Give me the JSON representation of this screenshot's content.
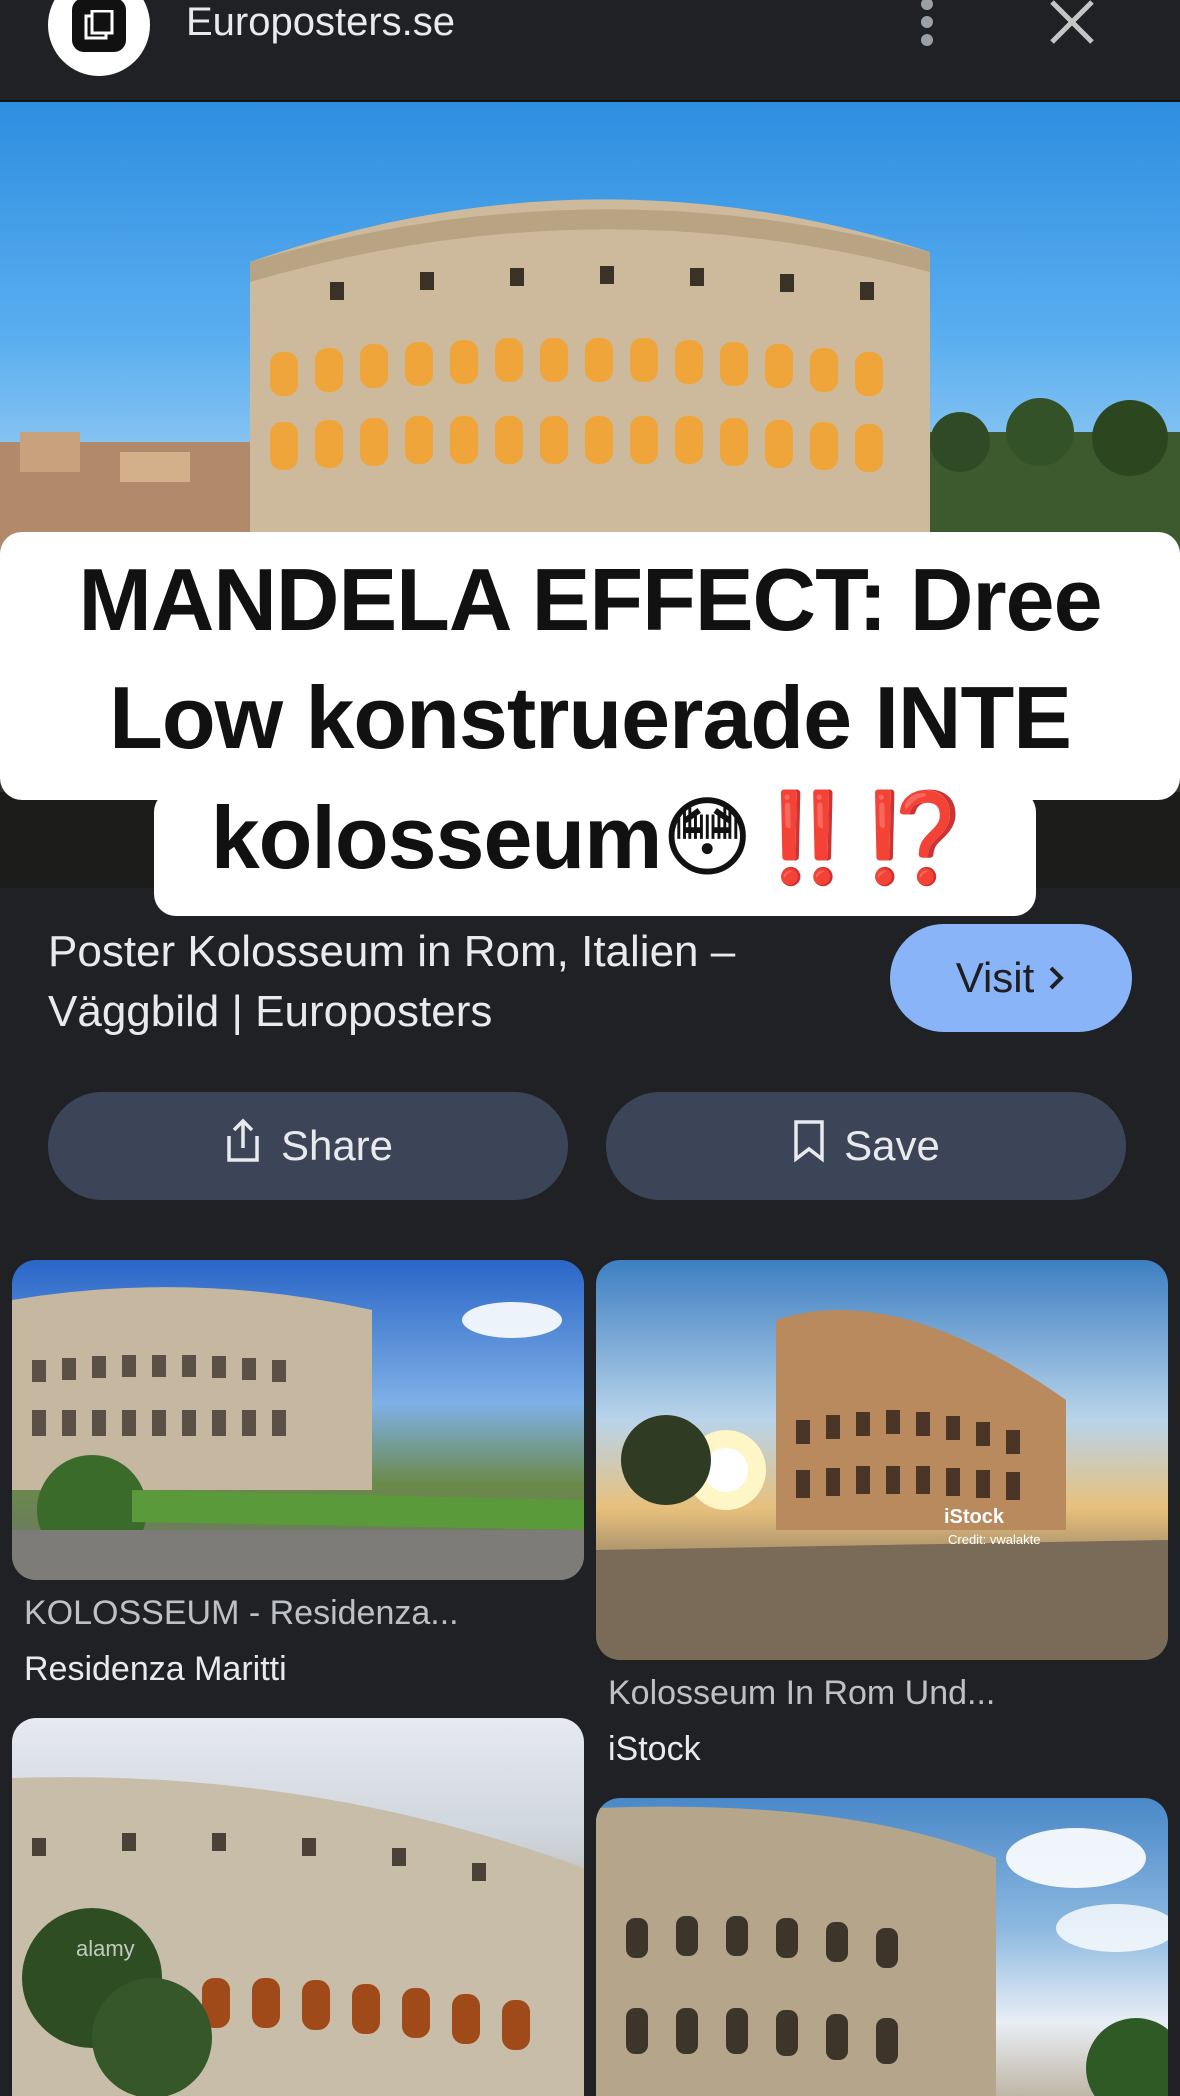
{
  "header": {
    "site_name": "Europosters.se",
    "site_icon": "collections-icon",
    "more_icon": "more-vert-icon",
    "close_icon": "close-icon"
  },
  "overlay_caption": {
    "line1": "MANDELA EFFECT: Dree",
    "line2": "Low konstruerade INTE",
    "line3": "kolosseum😳‼️⁉️"
  },
  "result": {
    "title_line1": "Poster Kolosseum in Rom, Italien –",
    "title_line2": "Väggbild | Europosters",
    "visit_label": "Visit"
  },
  "actions": {
    "share_label": "Share",
    "save_label": "Save"
  },
  "related": [
    {
      "title": "KOLOSSEUM - Residenza...",
      "source": "Residenza Maritti"
    },
    {
      "title": "Kolosseum In Rom Und...",
      "source": "iStock"
    }
  ],
  "image_watermarks": {
    "istock": "iStock",
    "istock_credit": "Credit: vwalakte",
    "alamy": "alamy"
  },
  "colors": {
    "background": "#202124",
    "visit_button": "#8ab4f8",
    "action_button": "#3c4557",
    "text_primary": "#e8eaed",
    "text_secondary": "#bdc1c6"
  }
}
